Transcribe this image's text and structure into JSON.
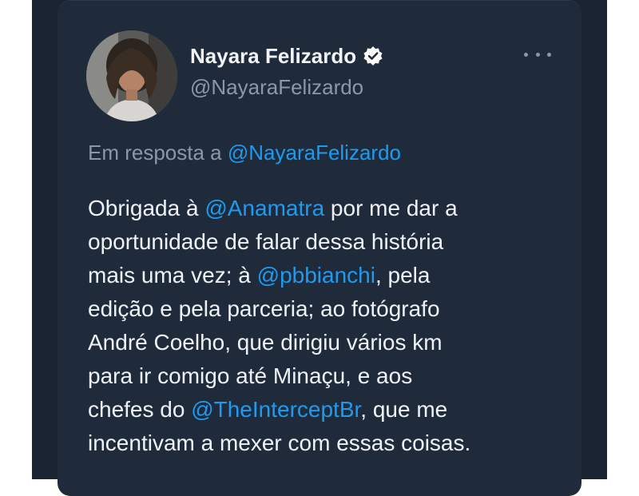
{
  "author": {
    "display_name": "Nayara Felizardo",
    "handle": "@NayaraFelizardo",
    "verified": true
  },
  "reply": {
    "prefix": "Em resposta a ",
    "mention": "@NayaraFelizardo"
  },
  "tweet": {
    "lines": [
      [
        {
          "t": "Obrigada à "
        },
        {
          "t": "@Anamatra",
          "m": true
        },
        {
          "t": " por me dar a"
        }
      ],
      [
        {
          "t": "oportunidade de falar dessa história"
        }
      ],
      [
        {
          "t": "mais uma vez; à "
        },
        {
          "t": "@pbbianchi",
          "m": true
        },
        {
          "t": ", pela"
        }
      ],
      [
        {
          "t": "edição e pela parceria; ao fotógrafo"
        }
      ],
      [
        {
          "t": "André Coelho, que dirigiu vários km"
        }
      ],
      [
        {
          "t": "para ir comigo até Minaçu, e aos"
        }
      ],
      [
        {
          "t": "chefes do "
        },
        {
          "t": "@TheInterceptBr",
          "m": true
        },
        {
          "t": ", que me"
        }
      ],
      [
        {
          "t": "incentivam a mexer com essas coisas."
        }
      ]
    ]
  },
  "icons": {
    "verified": "verified-badge-icon",
    "more": "more-options-icon"
  },
  "colors": {
    "background": "#1a2432",
    "card": "#1f2b3b",
    "text": "#eef2f6",
    "secondary": "#8b98a7",
    "link": "#1d9bf0"
  }
}
